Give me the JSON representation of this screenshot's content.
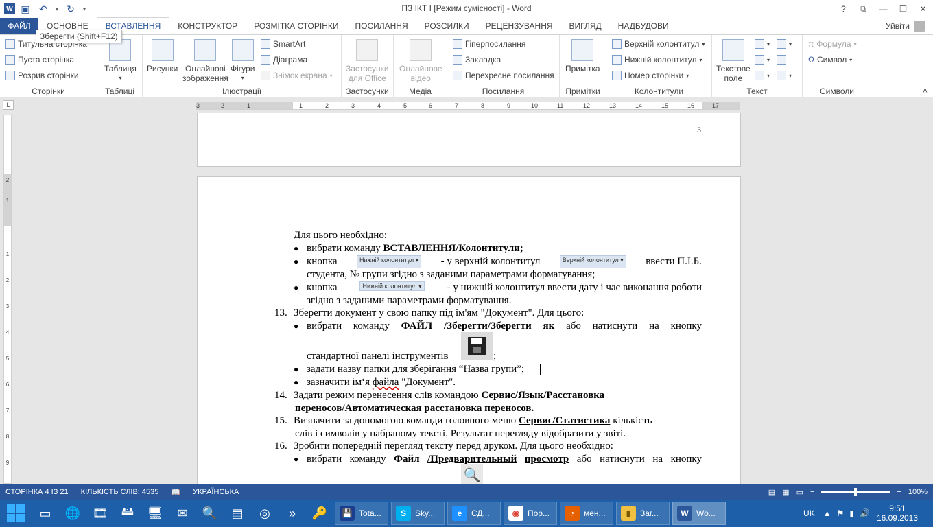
{
  "title_bar": {
    "title": "ПЗ ІКТ І [Режим сумісності] - Word",
    "help": "?",
    "ribbon_opts": "⧉",
    "minimize": "—",
    "restore": "❐",
    "close": "✕"
  },
  "tooltip": "Зберегти (Shift+F12)",
  "tabs": [
    "ФАЙЛ",
    "ОСНОВНЕ",
    "ВСТАВЛЕННЯ",
    "КОНСТРУКТОР",
    "РОЗМІТКА СТОРІНКИ",
    "ПОСИЛАННЯ",
    "РОЗСИЛКИ",
    "РЕЦЕНЗУВАННЯ",
    "ВИГЛЯД",
    "НАДБУДОВИ"
  ],
  "user": "Уйвіти",
  "ribbon": {
    "pages": {
      "label": "Сторінки",
      "cover": "Титульна сторінка",
      "blank": "Пуста сторінка",
      "break": "Розрив сторінки"
    },
    "tables": {
      "label": "Таблиці",
      "table": "Таблиця"
    },
    "illustrations": {
      "label": "Ілюстрації",
      "pictures": "Рисунки",
      "online1": "Онлайнові",
      "online2": "зображення",
      "shapes": "Фігури",
      "smartart": "SmartArt",
      "chart": "Діаграма",
      "screenshot": "Знімок екрана"
    },
    "addins": {
      "label": "Застосунки",
      "line1": "Застосунки",
      "line2": "для Office"
    },
    "media": {
      "label": "Медіа",
      "line1": "Онлайнове",
      "line2": "відео"
    },
    "links": {
      "label": "Посилання",
      "hyperlink": "Гіперпосилання",
      "bookmark": "Закладка",
      "crossref": "Перехресне посилання"
    },
    "comments": {
      "label": "Примітки",
      "comment": "Примітка"
    },
    "headerfooter": {
      "label": "Колонтитули",
      "header": "Верхній колонтитул",
      "footer": "Нижній колонтитул",
      "pagenum": "Номер сторінки"
    },
    "text": {
      "label": "Текст",
      "line1": "Текстове",
      "line2": "поле"
    },
    "symbols": {
      "label": "Символи",
      "equation": "Формула",
      "symbol": "Символ"
    }
  },
  "ruler": {
    "corner": "L",
    "h_ticks": [
      "3",
      "2",
      "1",
      "1",
      "2",
      "3",
      "4",
      "5",
      "6",
      "7",
      "8",
      "9",
      "10",
      "11",
      "12",
      "13",
      "14",
      "15",
      "16",
      "17"
    ],
    "v_ticks": [
      "2",
      "1",
      "1",
      "2",
      "3",
      "4",
      "5",
      "6",
      "7",
      "8",
      "9"
    ]
  },
  "document": {
    "page3_number": "3",
    "l1": "Для цього необхідно:",
    "l2a": "вибрати команду ",
    "l2b": "ВСТАВЛЕННЯ/Колонтитули;",
    "l3a": "кнопка",
    "l3btn": "Нижній колонтитул ▾",
    "l3b": "- у верхній колонтитул",
    "l3btn2": "Верхній колонтитул ▾",
    "l3c": "ввести П.І.Б.",
    "l4": "студента, № групи згідно з заданими параметрами форматування;",
    "l5a": "кнопка",
    "l5btn": "Нижній колонтитул ▾",
    "l5b": "- у нижній колонтитул ввести дату і час виконання роботи",
    "l6": "згідно з заданими параметрами форматування.",
    "n13": "13.",
    "l7": "Зберегти документ у свою папку під ім'ям \"Документ\". Для цього:",
    "l8a": "вибрати",
    "l8b": "команду",
    "l8c": "ФАЙЛ",
    "l8d": "/Зберегти/Зберегти",
    "l8e": "як",
    "l8f": "або",
    "l8g": "натиснути",
    "l8h": "на",
    "l8i": "кнопку",
    "l9": "стандартної панелі інструментів",
    "l9end": ";",
    "l10": "задати назву папки для зберігання “Назва групи”;",
    "l11a": "зазначити ім‘я ",
    "l11b": "файла",
    "l11c": " \"Документ\".",
    "n14": "14.",
    "l12a": "Задати режим перенесення слів командою ",
    "l12b": "Сервис/Язык/Расстановка",
    "l13": "переносов/Автоматическая расстановка переносов.",
    "n15": "15.",
    "l14a": "Визначити за допомогою команди головного меню ",
    "l14b": "Сервис/Статистика",
    "l14c": "  кількість",
    "l15": "слів і символів у набраному тексті. Результат перегляду відобразити у звіті.",
    "n16": "16.",
    "l16": "Зробити попередній перегляд тексту перед друком. Для цього необхідно:",
    "l17a": "вибрати",
    "l17b": "команду",
    "l17c": "Файл",
    "l17d": "/Предварительный",
    "l17e": "просмотр",
    "l17f": "або",
    "l17g": "натиснути",
    "l17h": "на",
    "l17i": "кнопку"
  },
  "status": {
    "page": "СТОРІНКА 4 ІЗ 21",
    "words": "КІЛЬКІСТЬ СЛІВ: 4535",
    "lang": "УКРАЇНСЬКА",
    "zoom": "100%"
  },
  "taskbar": {
    "apps": [
      {
        "label": "Tota...",
        "color": "#1a3d8f",
        "glyph": "💾"
      },
      {
        "label": "Sky...",
        "color": "#00aff0",
        "glyph": "S"
      },
      {
        "label": "СД...",
        "color": "#1e90ff",
        "glyph": "e"
      },
      {
        "label": "Пор...",
        "color": "#ffffff",
        "glyph": "◉"
      },
      {
        "label": "мен...",
        "color": "#e66000",
        "glyph": "◔"
      },
      {
        "label": "Заг...",
        "color": "#f0c040",
        "glyph": "▮"
      },
      {
        "label": "Wo...",
        "color": "#2b579a",
        "glyph": "W"
      }
    ],
    "lang": "UK",
    "time": "9:51",
    "date": "16.09.2013"
  }
}
